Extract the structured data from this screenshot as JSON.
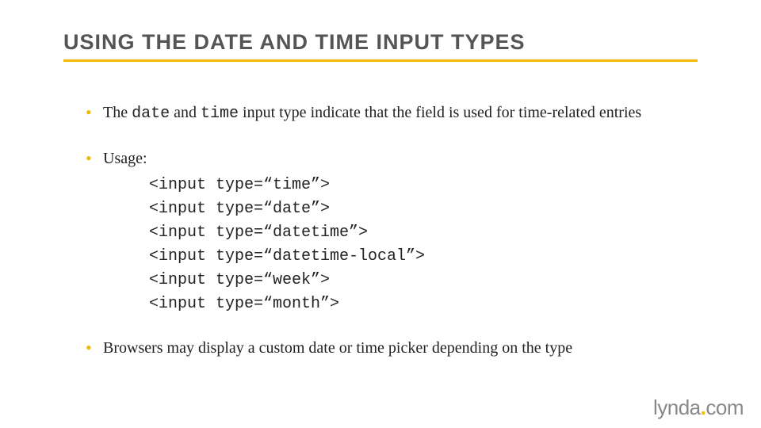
{
  "title": "USING THE DATE AND TIME INPUT TYPES",
  "bullets": {
    "b1_pre": "The ",
    "b1_code1": "date",
    "b1_mid": " and ",
    "b1_code2": "time",
    "b1_post": " input type indicate that the field is used for time-related entries",
    "b2_label": "Usage:",
    "b3": "Browsers may display a custom date or time picker depending on the type"
  },
  "code": {
    "l1": "<input type=“time”>",
    "l2": "<input type=“date”>",
    "l3": "<input type=“datetime”>",
    "l4": "<input type=“datetime-local”>",
    "l5": "<input type=“week”>",
    "l6": "<input type=“month”>"
  },
  "footer": {
    "brand": "lynda",
    "dot": ".",
    "tld": "com"
  }
}
